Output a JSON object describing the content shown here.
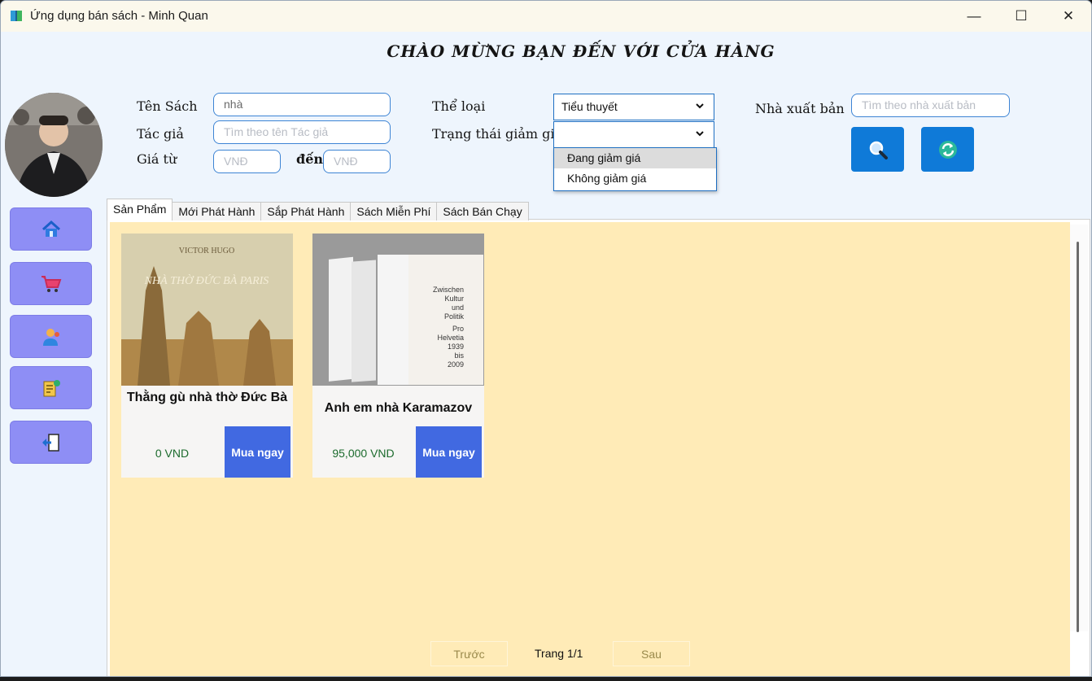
{
  "window": {
    "title": "Ứng dụng bán sách - Minh Quan",
    "minimize": "—",
    "maximize": "☐",
    "close": "✕"
  },
  "header": {
    "welcome": "CHÀO MỪNG BẠN ĐẾN VỚI CỬA HÀNG"
  },
  "filters": {
    "book_name_label": "Tên Sách",
    "book_name_value": "nhà",
    "author_label": "Tác giả",
    "author_placeholder": "Tìm theo tên Tác giả",
    "price_from_label": "Giá từ",
    "price_from_placeholder": "VNĐ",
    "price_to_label": "đến",
    "price_to_placeholder": "VNĐ",
    "category_label": "Thể loại",
    "category_value": "Tiểu thuyết",
    "discount_label": "Trạng thái giảm giá",
    "discount_value": "",
    "discount_options": [
      "Đang giảm giá",
      "Không giảm giá"
    ],
    "publisher_label": "Nhà xuất bản",
    "publisher_placeholder": "Tìm theo nhà xuất bản"
  },
  "actions": {
    "search_icon": "search-icon",
    "refresh_icon": "refresh-icon"
  },
  "sidebar": {
    "items": [
      "home-icon",
      "cart-icon",
      "user-icon",
      "orders-icon",
      "logout-icon"
    ]
  },
  "tabs": [
    "Sản Phẩm",
    "Mới Phát Hành",
    "Sắp Phát Hành",
    "Sách Miễn Phí",
    "Sách Bán Chạy"
  ],
  "products": [
    {
      "title": "Thằng gù nhà thờ Đức Bà",
      "price": "0 VND",
      "buy_label": "Mua ngay",
      "cover_author": "VICTOR HUGO",
      "cover_title": "NHÀ THỜ ĐỨC BÀ PARIS"
    },
    {
      "title": "Anh em nhà Karamazov",
      "price": "95,000 VND",
      "buy_label": "Mua ngay",
      "cover_text": [
        "Zwischen",
        "Kultur",
        "und",
        "Politik",
        "Pro",
        "Helvetia",
        "1939",
        "bis",
        "2009"
      ]
    }
  ],
  "pagination": {
    "prev": "Trước",
    "page_info": "Trang 1/1",
    "next": "Sau"
  },
  "colors": {
    "accent_blue": "#0f7ad8",
    "sidebar_button": "#8e8ef5",
    "buy_button": "#4169e1",
    "content_bg": "#ffebb7"
  }
}
